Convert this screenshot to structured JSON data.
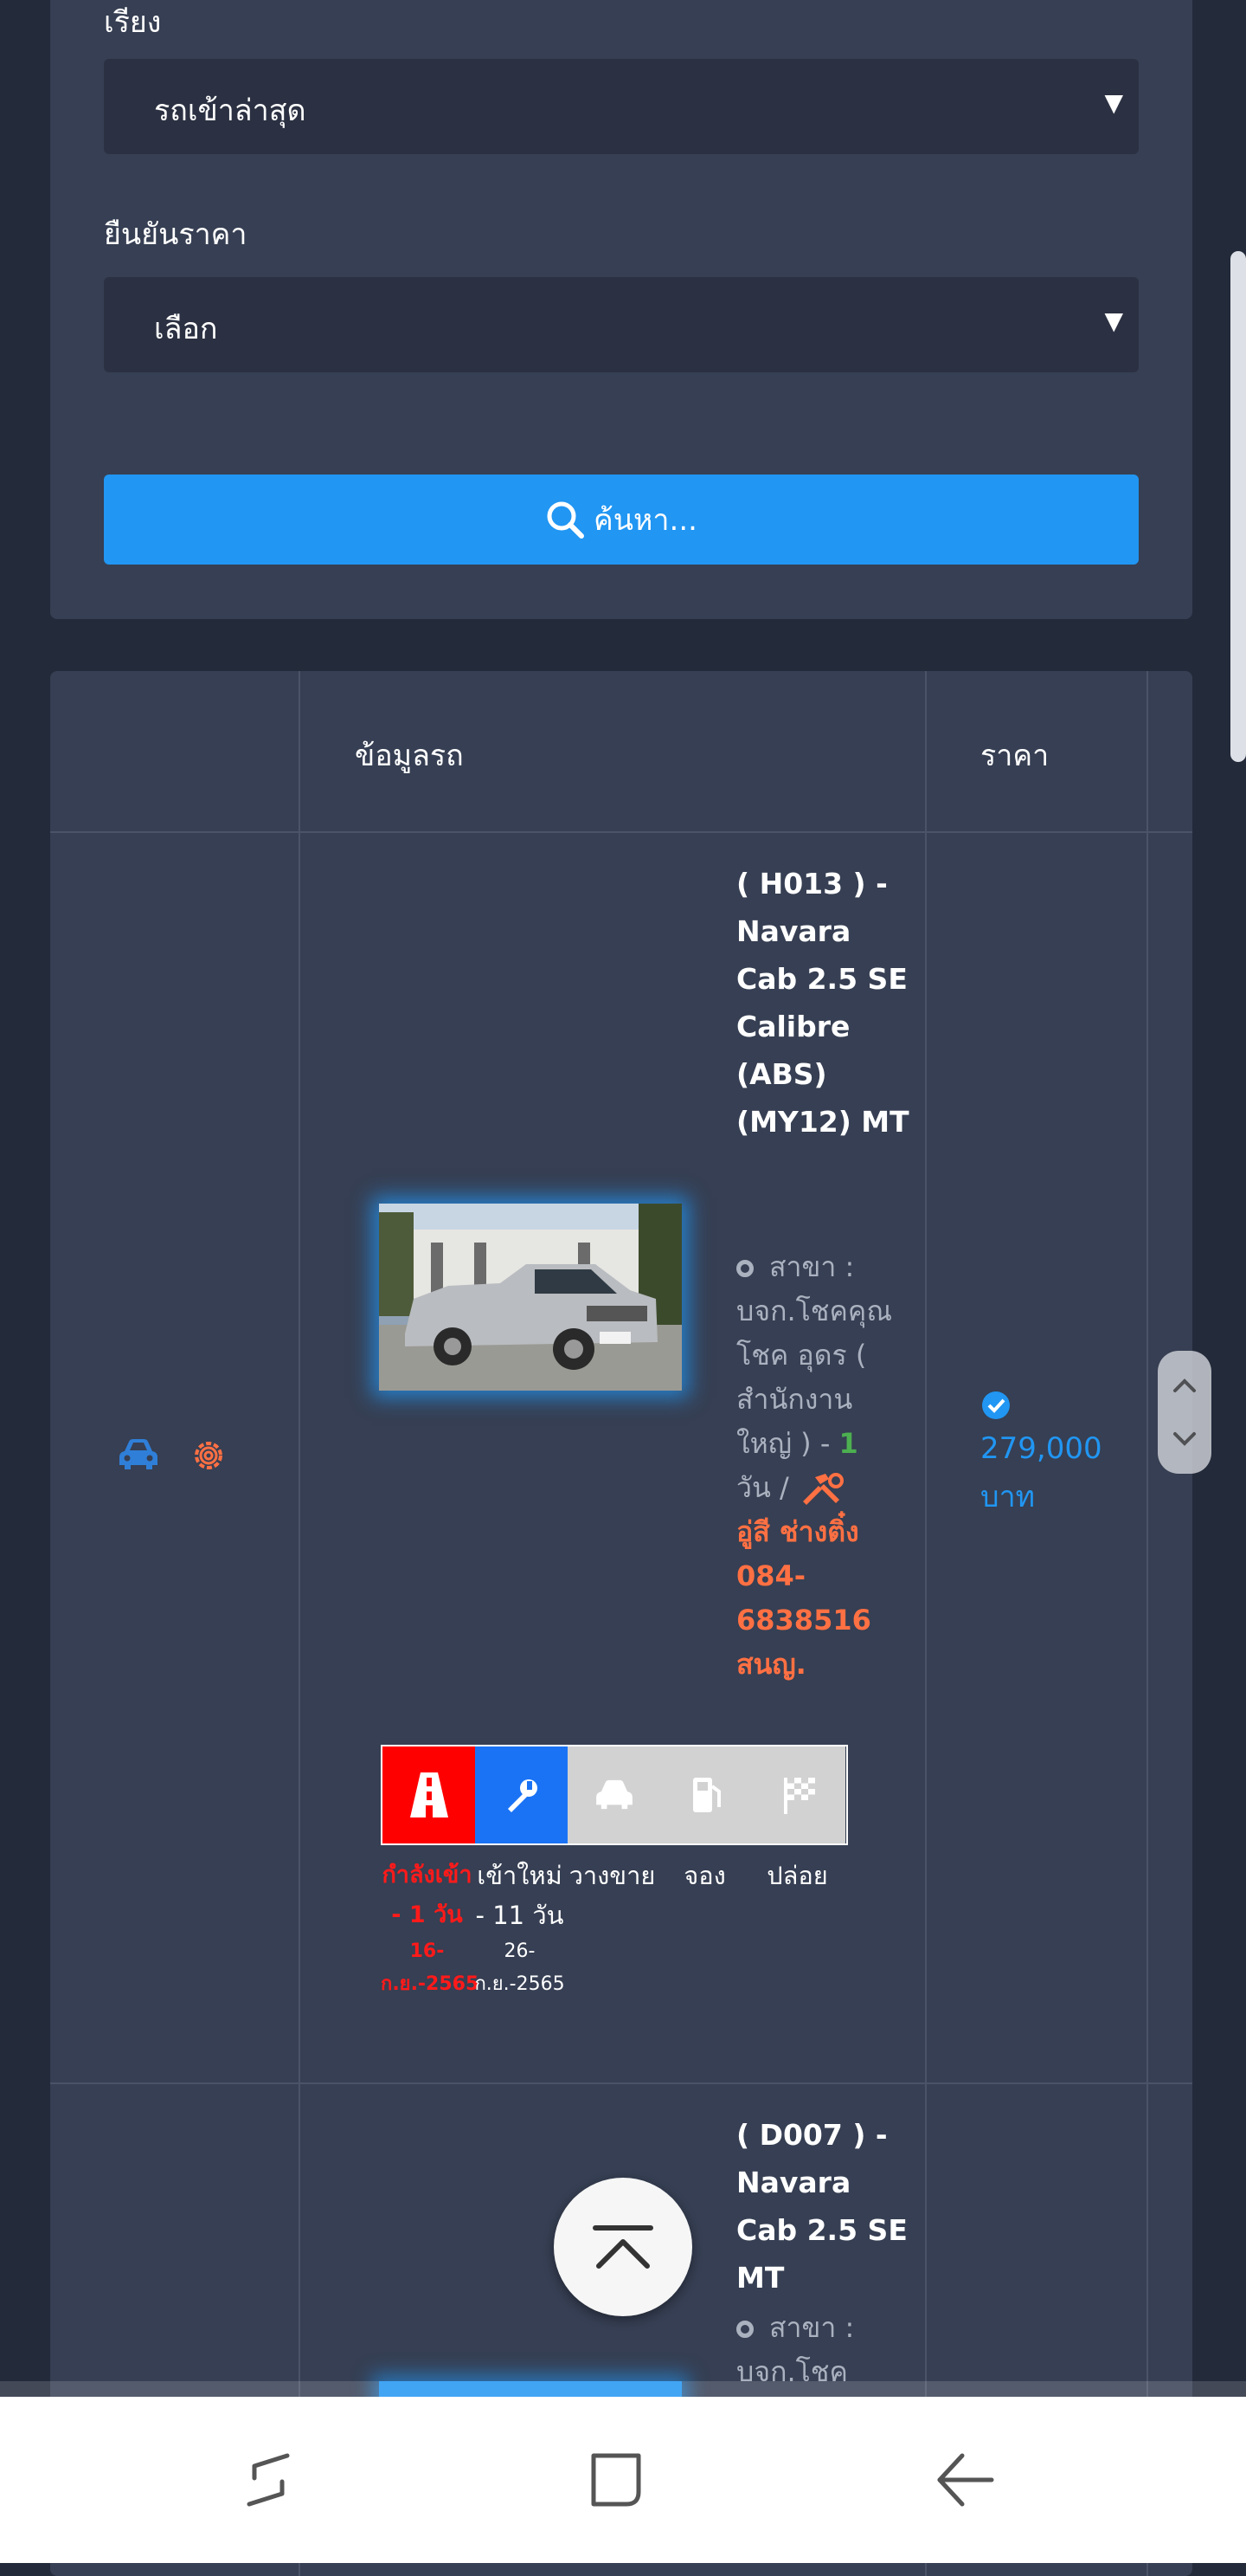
{
  "filters": {
    "sort_label": "เรียง",
    "sort_value": "รถเข้าล่าสุด",
    "price_label": "ยืนยันราคา",
    "price_value": "เลือก",
    "search_button": "ค้นหา..."
  },
  "table": {
    "headers": [
      "ข้อมูลรถ",
      "ราคา"
    ],
    "rows": [
      {
        "title": "( H013 ) - Navara Cab 2.5 SE Calibre (ABS) (MY12) MT",
        "branch_prefix": "สาขา : บจก.โชคคุณโชค อุดร ( สำนักงานใหญ่ ) - ",
        "days": "1",
        "days_suffix": "วัน / ",
        "tech": "อู่สี ช่างติ๋ง 084-6838516 สนญ.",
        "price": "279,000 บาท",
        "statuses": [
          {
            "label": "กำลังเข้า - 1 วัน",
            "date": "16-ก.ย.-2565",
            "color": "#ff1a1a"
          },
          {
            "label": "เข้าใหม่ - 11 วัน",
            "date": "26-ก.ย.-2565",
            "color": "#ffffff"
          },
          {
            "label": "วางขาย",
            "date": "",
            "color": "#ffffff"
          },
          {
            "label": "จอง",
            "date": "",
            "color": "#ffffff"
          },
          {
            "label": "ปล่อย",
            "date": "",
            "color": "#ffffff"
          }
        ]
      },
      {
        "title": "( D007 ) - Navara Cab 2.5 SE MT",
        "branch_prefix": "สาขา : บจก.โชค"
      }
    ]
  },
  "colors": {
    "accent": "#2196f3",
    "danger": "#ff0000",
    "orange": "#ff7043"
  }
}
